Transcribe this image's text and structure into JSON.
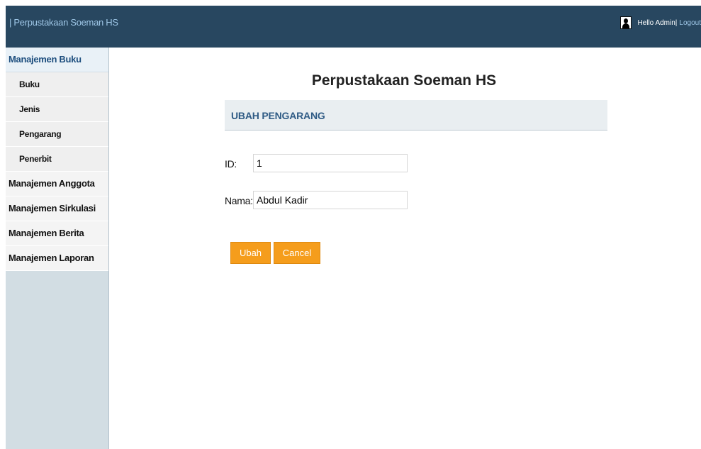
{
  "header": {
    "brand": "| Perpustakaan Soeman HS",
    "greeting": "Hello Admin",
    "separator": " |",
    "logout": "Logout"
  },
  "sidebar": {
    "sections": [
      {
        "label": "Manajemen Buku",
        "items": [
          "Buku",
          "Jenis",
          "Pengarang",
          "Penerbit"
        ]
      },
      {
        "label": "Manajemen Anggota"
      },
      {
        "label": "Manajemen Sirkulasi"
      },
      {
        "label": "Manajemen Berita"
      },
      {
        "label": "Manajemen Laporan"
      }
    ]
  },
  "main": {
    "title": "Perpustakaan Soeman HS",
    "section_title": "UBAH PENGARANG",
    "form": {
      "id_label": "ID:",
      "id_value": "1",
      "name_label": "Nama:",
      "name_value": "Abdul Kadir"
    },
    "buttons": {
      "submit": "Ubah",
      "cancel": "Cancel"
    }
  },
  "colors": {
    "topbar": "#284760",
    "sidebar": "#d2dde3",
    "button": "#f59d1c",
    "section_title": "#2f5b85"
  },
  "icons": {
    "avatar": "user-silhouette-icon"
  }
}
